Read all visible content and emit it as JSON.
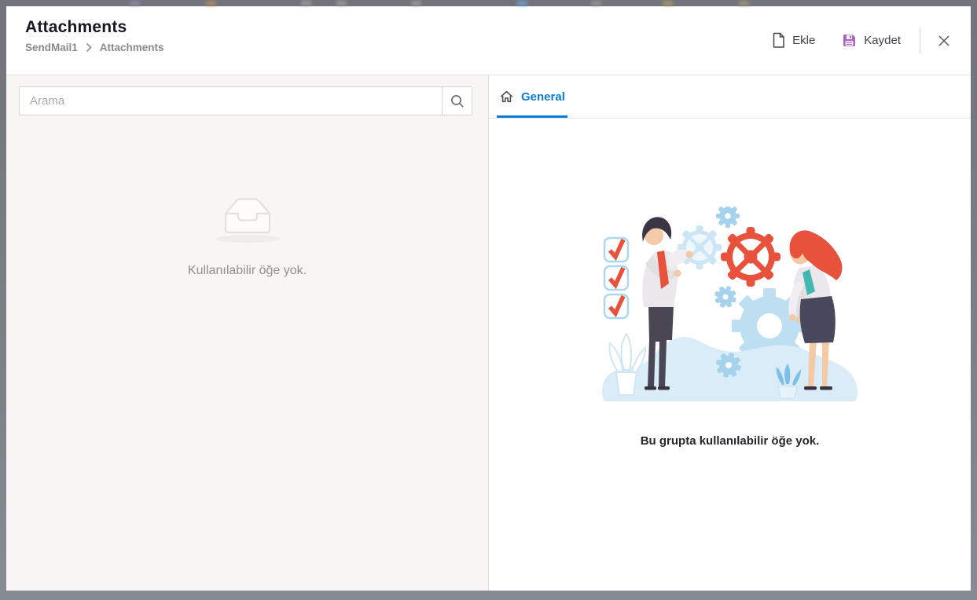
{
  "window": {
    "title": "Attachments",
    "breadcrumb": {
      "parent": "SendMail1",
      "current": "Attachments"
    }
  },
  "toolbar": {
    "add_label": "Ekle",
    "save_label": "Kaydet",
    "icons": {
      "add": "document-icon",
      "save": "floppy-disk-icon",
      "close": "close-icon"
    }
  },
  "left_panel": {
    "search": {
      "placeholder": "Arama",
      "value": "",
      "icon": "search-icon"
    },
    "empty_state": {
      "icon": "inbox-tray-icon",
      "text": "Kullanılabilir öğe yok."
    }
  },
  "right_panel": {
    "tabs": [
      {
        "label": "General",
        "icon": "home-icon",
        "active": true
      }
    ],
    "empty_state": {
      "illustration": "teamwork-gears-illustration",
      "text": "Bu grupta kullanılabilir öğe yok."
    }
  },
  "colors": {
    "accent-blue": "#0b7cd4",
    "accent-purple": "#ab63c2",
    "illustration-red": "#e8513b",
    "illustration-blue": "#a5d2ed",
    "illustration-pale-blue": "#cde6f5",
    "frame": "#777b82",
    "left-panel-bg": "#f7f6f5"
  }
}
